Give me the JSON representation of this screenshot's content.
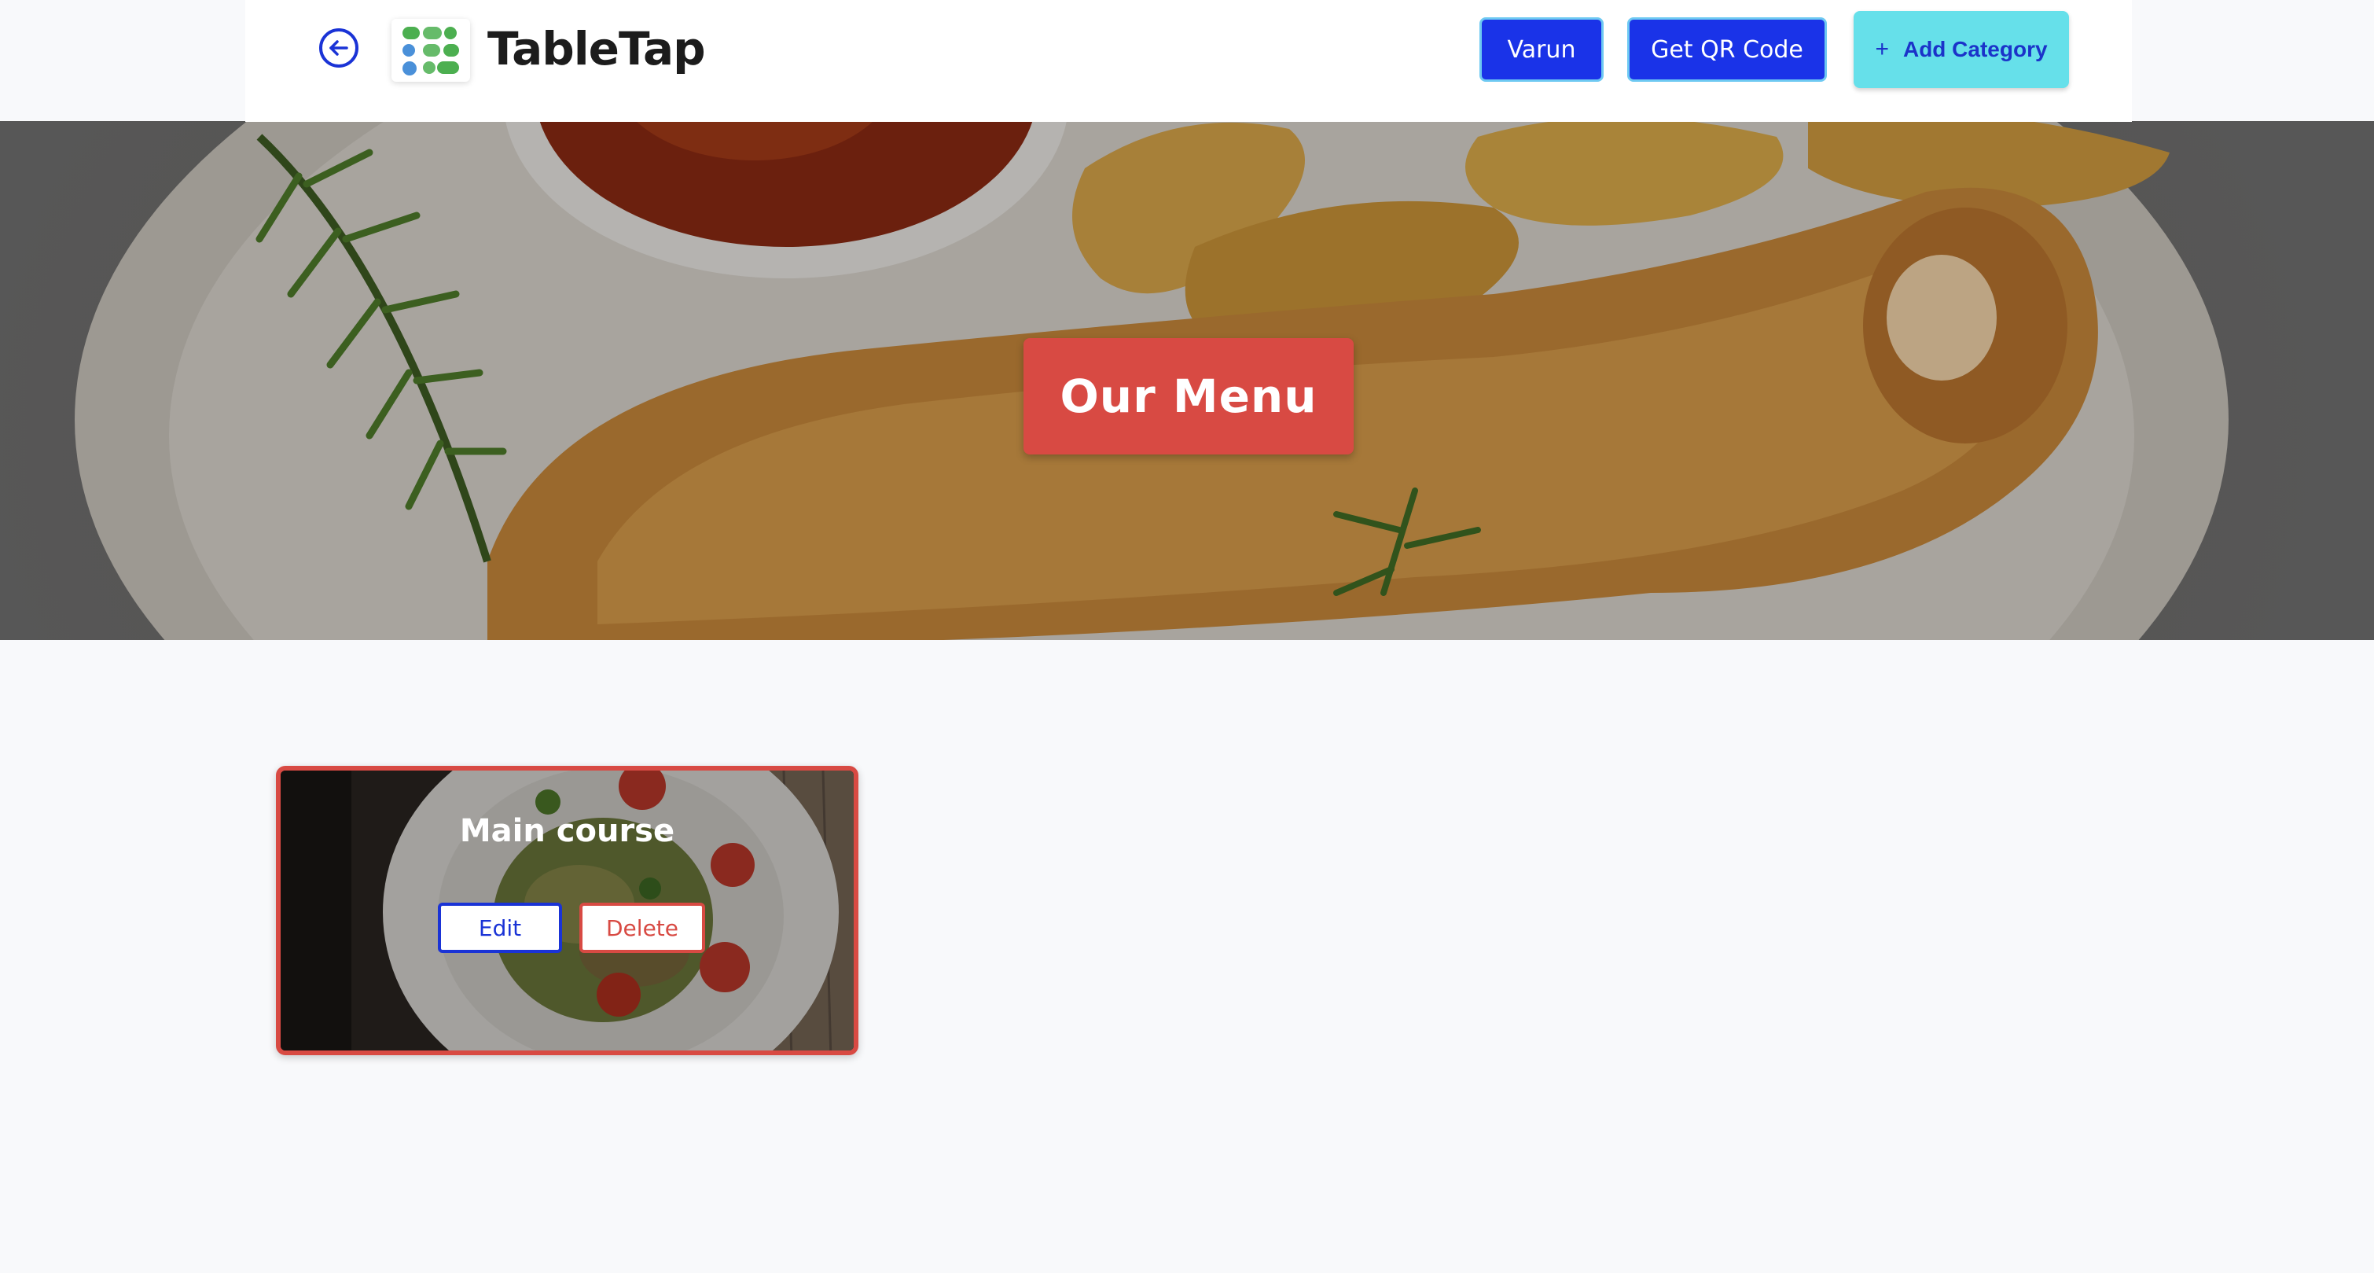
{
  "header": {
    "brand_name": "TableTap",
    "user_button_label": "Varun",
    "qr_button_label": "Get QR Code",
    "add_category_label": "Add Category",
    "add_category_icon": "+",
    "back_icon": "arrow-left-circle-icon",
    "logo_icon": "tabletap-logo-icon"
  },
  "hero": {
    "title": "Our Menu"
  },
  "categories": [
    {
      "name": "Main course",
      "edit_label": "Edit",
      "delete_label": "Delete"
    }
  ],
  "colors": {
    "primary_blue": "#1a33e8",
    "accent_red": "#d84a43",
    "accent_cyan": "#66e0ea",
    "page_background": "#f8f9fb"
  }
}
